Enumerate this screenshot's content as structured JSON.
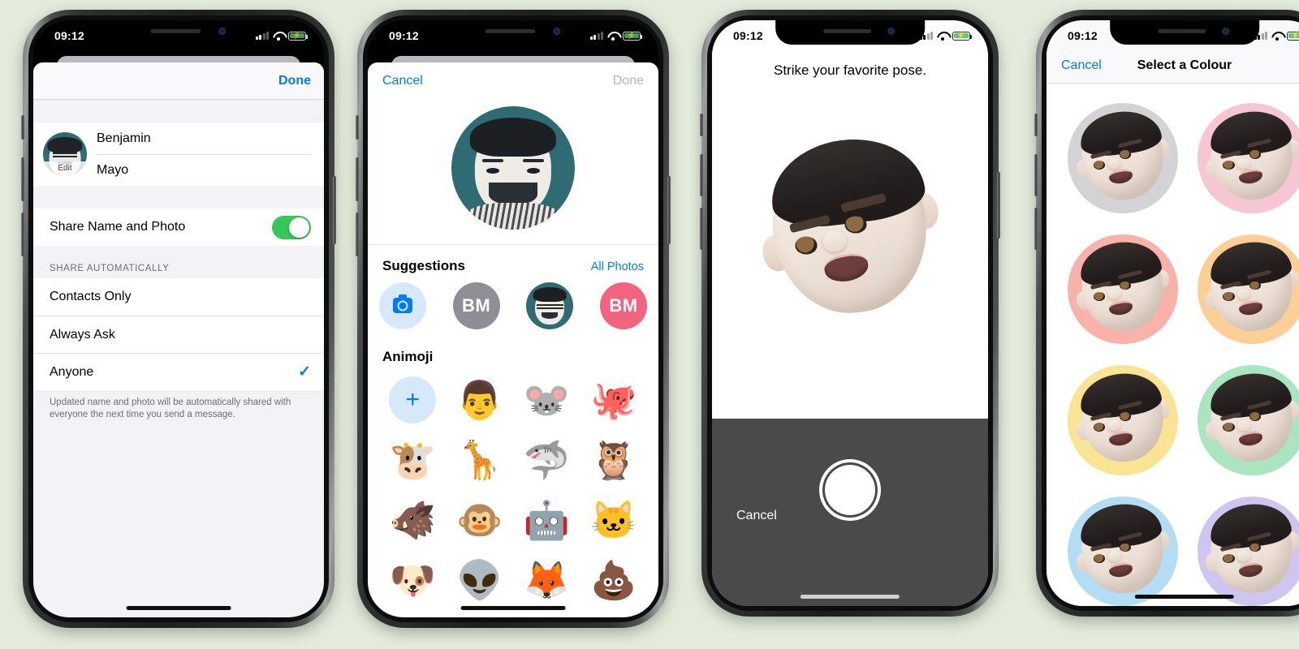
{
  "background_color": "#e3ecdc",
  "status_bar": {
    "time": "09:12",
    "signal": "signal-bars",
    "wifi": "wifi-icon",
    "battery": "battery-charging-icon"
  },
  "phone1": {
    "nav": {
      "done_label": "Done"
    },
    "name": {
      "first": "Benjamin",
      "last": "Mayo"
    },
    "avatar_edit_label": "Edit",
    "share_row": {
      "label": "Share Name and Photo",
      "toggle_on": true,
      "toggle_color": "#34c759"
    },
    "section_header": "SHARE AUTOMATICALLY",
    "options": [
      {
        "label": "Contacts Only",
        "selected": false
      },
      {
        "label": "Always Ask",
        "selected": false
      },
      {
        "label": "Anyone",
        "selected": true
      }
    ],
    "footnote": "Updated name and photo will be automatically shared with everyone the next time you send a message."
  },
  "phone2": {
    "nav": {
      "cancel_label": "Cancel",
      "done_label": "Done"
    },
    "suggestions": {
      "title": "Suggestions",
      "all_photos_label": "All Photos",
      "items": [
        {
          "kind": "camera",
          "label": "",
          "color": "#d6e9fb"
        },
        {
          "kind": "initials",
          "label": "BM",
          "color": "#8e8e97"
        },
        {
          "kind": "photo",
          "label": "",
          "color": "#2e6b73"
        },
        {
          "kind": "initials",
          "label": "BM",
          "color": "#f1637f"
        }
      ]
    },
    "animoji": {
      "title": "Animoji",
      "items": [
        {
          "name": "add-animoji",
          "glyph": "+"
        },
        {
          "name": "memoji-face",
          "glyph": "👨"
        },
        {
          "name": "mouse",
          "glyph": "🐭"
        },
        {
          "name": "octopus",
          "glyph": "🐙"
        },
        {
          "name": "cow",
          "glyph": "🐮"
        },
        {
          "name": "giraffe",
          "glyph": "🦒"
        },
        {
          "name": "shark",
          "glyph": "🦈"
        },
        {
          "name": "owl",
          "glyph": "🦉"
        },
        {
          "name": "boar",
          "glyph": "🐗"
        },
        {
          "name": "monkey",
          "glyph": "🐵"
        },
        {
          "name": "robot",
          "glyph": "🤖"
        },
        {
          "name": "cat",
          "glyph": "🐱"
        },
        {
          "name": "dog",
          "glyph": "🐶"
        },
        {
          "name": "alien",
          "glyph": "👽"
        },
        {
          "name": "fox",
          "glyph": "🦊"
        },
        {
          "name": "poop",
          "glyph": "💩"
        }
      ]
    }
  },
  "phone3": {
    "prompt": "Strike your favorite pose.",
    "cancel_label": "Cancel",
    "shutter_label": "shutter-button",
    "tray_color": "#4a4a4a"
  },
  "phone4": {
    "nav": {
      "cancel_label": "Cancel",
      "title": "Select a Colour"
    },
    "colours": [
      {
        "name": "grey",
        "hex": "#d3d3d5"
      },
      {
        "name": "pink",
        "hex": "#f6c6d3"
      },
      {
        "name": "salmon",
        "hex": "#f8b2aa"
      },
      {
        "name": "orange",
        "hex": "#fbcf95"
      },
      {
        "name": "yellow",
        "hex": "#f9e494"
      },
      {
        "name": "green",
        "hex": "#a9e6bf"
      },
      {
        "name": "blue",
        "hex": "#b3ddf2"
      },
      {
        "name": "purple",
        "hex": "#cfc6f0"
      }
    ]
  }
}
